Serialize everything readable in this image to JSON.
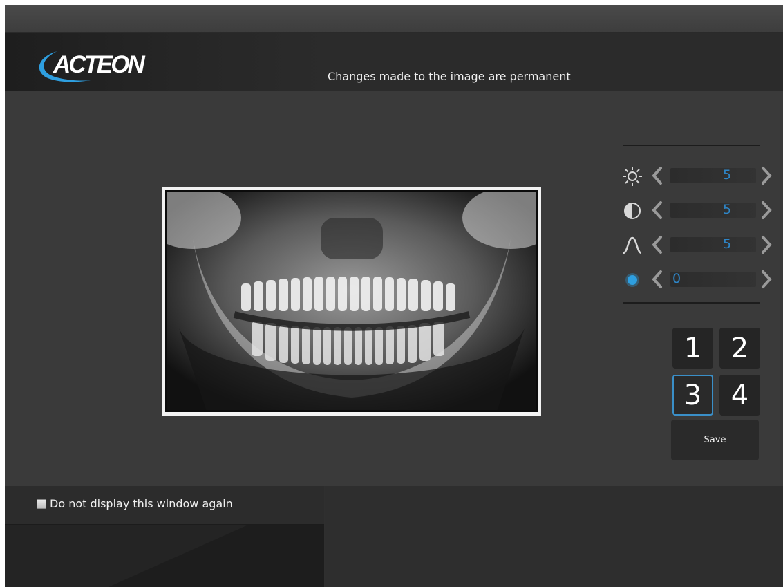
{
  "brand": {
    "logo_text": "ACTEON",
    "accent_color": "#2e9fe0"
  },
  "header": {
    "notice": "Changes made to the image are permanent"
  },
  "image": {
    "description_icon": "panoramic-xray"
  },
  "adjustments": [
    {
      "name": "brightness",
      "icon": "sun-icon",
      "value": "5"
    },
    {
      "name": "contrast",
      "icon": "half-circle-icon",
      "value": "5"
    },
    {
      "name": "gamma",
      "icon": "curve-icon",
      "value": "5"
    },
    {
      "name": "filter",
      "icon": "blue-dot-icon",
      "value": "0"
    }
  ],
  "presets": {
    "buttons": [
      "1",
      "2",
      "3",
      "4"
    ],
    "active": "3",
    "save_label": "Save"
  },
  "footer": {
    "checkbox_label": "Do not display this window again",
    "checked": false
  },
  "colors": {
    "value_text": "#2e86c8",
    "active_border": "#3a8fc8"
  }
}
